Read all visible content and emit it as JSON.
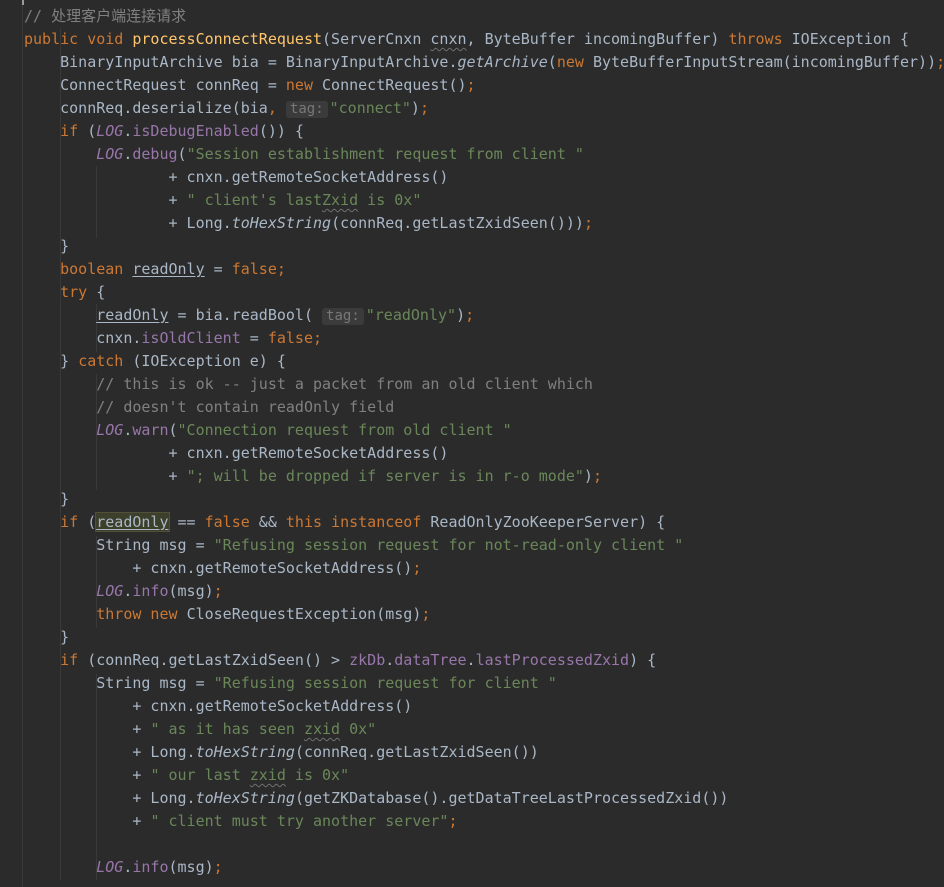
{
  "code_lines": [
    [
      {
        "c": "cmt",
        "t": "// 处理客户端连接请求"
      }
    ],
    [
      {
        "c": "kw",
        "t": "public void "
      },
      {
        "c": "fn",
        "t": "processConnectRequest"
      },
      {
        "c": "plain",
        "t": "(ServerCnxn "
      },
      {
        "c": "plain sq",
        "t": "cnxn"
      },
      {
        "c": "plain",
        "t": ", ByteBuffer incomingBuffer) "
      },
      {
        "c": "kw",
        "t": "throws "
      },
      {
        "c": "plain",
        "t": "IOException {"
      }
    ],
    [
      {
        "c": "plain",
        "t": "    BinaryInputArchive bia = BinaryInputArchive."
      },
      {
        "c": "plain smeth",
        "t": "getArchive"
      },
      {
        "c": "plain",
        "t": "("
      },
      {
        "c": "kw",
        "t": "new "
      },
      {
        "c": "plain",
        "t": "ByteBufferInputStream(incomingBuffer))"
      },
      {
        "c": "kw",
        "t": ";"
      }
    ],
    [
      {
        "c": "plain",
        "t": "    ConnectRequest connReq = "
      },
      {
        "c": "kw",
        "t": "new "
      },
      {
        "c": "plain",
        "t": "ConnectRequest()"
      },
      {
        "c": "kw",
        "t": ";"
      }
    ],
    [
      {
        "c": "plain",
        "t": "    connReq.deserialize(bia"
      },
      {
        "c": "kw",
        "t": ", "
      },
      {
        "c": "hint",
        "t": "tag:"
      },
      {
        "c": "str",
        "t": "\"connect\""
      },
      {
        "c": "plain",
        "t": ")"
      },
      {
        "c": "kw",
        "t": ";"
      }
    ],
    [
      {
        "c": "kw",
        "t": "    if "
      },
      {
        "c": "plain",
        "t": "("
      },
      {
        "c": "sfld",
        "t": "LOG"
      },
      {
        "c": "plain",
        "t": "."
      },
      {
        "c": "fld",
        "t": "isDebugEnabled"
      },
      {
        "c": "plain",
        "t": "()) {"
      }
    ],
    [
      {
        "c": "sfld",
        "t": "        LOG"
      },
      {
        "c": "plain",
        "t": "."
      },
      {
        "c": "fld",
        "t": "debug"
      },
      {
        "c": "plain",
        "t": "("
      },
      {
        "c": "str",
        "t": "\"Session establishment request from client \""
      }
    ],
    [
      {
        "c": "plain",
        "t": "                + cnxn.getRemoteSocketAddress()"
      }
    ],
    [
      {
        "c": "plain",
        "t": "                + "
      },
      {
        "c": "str",
        "t": "\" client's last"
      },
      {
        "c": "str sq",
        "t": "Zxid"
      },
      {
        "c": "str",
        "t": " is 0x\""
      }
    ],
    [
      {
        "c": "plain",
        "t": "                + Long."
      },
      {
        "c": "plain smeth",
        "t": "toHexString"
      },
      {
        "c": "plain",
        "t": "(connReq.getLastZxidSeen()))"
      },
      {
        "c": "kw",
        "t": ";"
      }
    ],
    [
      {
        "c": "plain",
        "t": "    }"
      }
    ],
    [
      {
        "c": "kw",
        "t": "    boolean "
      },
      {
        "c": "plain u",
        "t": "readOnly"
      },
      {
        "c": "plain",
        "t": " = "
      },
      {
        "c": "kw",
        "t": "false;"
      }
    ],
    [
      {
        "c": "kw",
        "t": "    try "
      },
      {
        "c": "plain",
        "t": "{"
      }
    ],
    [
      {
        "c": "plain",
        "t": "        "
      },
      {
        "c": "plain u",
        "t": "readOnly"
      },
      {
        "c": "plain",
        "t": " = bia.readBool( "
      },
      {
        "c": "hint",
        "t": "tag:"
      },
      {
        "c": "str",
        "t": "\"readOnly\""
      },
      {
        "c": "plain",
        "t": ")"
      },
      {
        "c": "kw",
        "t": ";"
      }
    ],
    [
      {
        "c": "plain",
        "t": "        cnxn."
      },
      {
        "c": "fld",
        "t": "isOldClient"
      },
      {
        "c": "plain",
        "t": " = "
      },
      {
        "c": "kw",
        "t": "false;"
      }
    ],
    [
      {
        "c": "plain",
        "t": "    } "
      },
      {
        "c": "kw",
        "t": "catch "
      },
      {
        "c": "plain",
        "t": "(IOException e) {"
      }
    ],
    [
      {
        "c": "cmt",
        "t": "        // this is ok -- just a packet from an old client which"
      }
    ],
    [
      {
        "c": "cmt",
        "t": "        // doesn't contain readOnly field"
      }
    ],
    [
      {
        "c": "sfld",
        "t": "        LOG"
      },
      {
        "c": "plain",
        "t": "."
      },
      {
        "c": "fld",
        "t": "warn"
      },
      {
        "c": "plain",
        "t": "("
      },
      {
        "c": "str",
        "t": "\"Connection request from old client \""
      }
    ],
    [
      {
        "c": "plain",
        "t": "                + cnxn.getRemoteSocketAddress()"
      }
    ],
    [
      {
        "c": "plain",
        "t": "                + "
      },
      {
        "c": "str",
        "t": "\"; will be dropped if server is in r-o mode\""
      },
      {
        "c": "plain",
        "t": ")"
      },
      {
        "c": "kw",
        "t": ";"
      }
    ],
    [
      {
        "c": "plain",
        "t": "    }"
      }
    ],
    [
      {
        "c": "kw",
        "t": "    if "
      },
      {
        "c": "plain",
        "t": "("
      },
      {
        "c": "plain u hl-box",
        "t": "readOnly"
      },
      {
        "c": "plain",
        "t": " == "
      },
      {
        "c": "kw",
        "t": "false"
      },
      {
        "c": "plain",
        "t": " && "
      },
      {
        "c": "kw",
        "t": "this instanceof "
      },
      {
        "c": "plain",
        "t": "ReadOnlyZooKeeperServer) {"
      }
    ],
    [
      {
        "c": "plain",
        "t": "        String msg = "
      },
      {
        "c": "str",
        "t": "\"Refusing session request for not-read-only client \""
      }
    ],
    [
      {
        "c": "plain",
        "t": "            + cnxn.getRemoteSocketAddress()"
      },
      {
        "c": "kw",
        "t": ";"
      }
    ],
    [
      {
        "c": "sfld",
        "t": "        LOG"
      },
      {
        "c": "plain",
        "t": "."
      },
      {
        "c": "fld",
        "t": "info"
      },
      {
        "c": "plain",
        "t": "(msg)"
      },
      {
        "c": "kw",
        "t": ";"
      }
    ],
    [
      {
        "c": "kw",
        "t": "        throw new "
      },
      {
        "c": "plain",
        "t": "CloseRequestException(msg)"
      },
      {
        "c": "kw",
        "t": ";"
      }
    ],
    [
      {
        "c": "plain",
        "t": "    }"
      }
    ],
    [
      {
        "c": "kw",
        "t": "    if "
      },
      {
        "c": "plain",
        "t": "(connReq.getLastZxidSeen() > "
      },
      {
        "c": "fld",
        "t": "zkDb"
      },
      {
        "c": "plain",
        "t": "."
      },
      {
        "c": "fld",
        "t": "dataTree"
      },
      {
        "c": "plain",
        "t": "."
      },
      {
        "c": "fld",
        "t": "lastProcessedZxid"
      },
      {
        "c": "plain",
        "t": ") {"
      }
    ],
    [
      {
        "c": "plain",
        "t": "        String msg = "
      },
      {
        "c": "str",
        "t": "\"Refusing session request for client \""
      }
    ],
    [
      {
        "c": "plain",
        "t": "            + cnxn.getRemoteSocketAddress()"
      }
    ],
    [
      {
        "c": "plain",
        "t": "            + "
      },
      {
        "c": "str",
        "t": "\" as it has seen "
      },
      {
        "c": "str sq",
        "t": "zxid"
      },
      {
        "c": "str",
        "t": " 0x\""
      }
    ],
    [
      {
        "c": "plain",
        "t": "            + Long."
      },
      {
        "c": "plain smeth",
        "t": "toHexString"
      },
      {
        "c": "plain",
        "t": "(connReq.getLastZxidSeen())"
      }
    ],
    [
      {
        "c": "plain",
        "t": "            + "
      },
      {
        "c": "str",
        "t": "\" our last "
      },
      {
        "c": "str sq",
        "t": "zxid"
      },
      {
        "c": "str",
        "t": " is 0x\""
      }
    ],
    [
      {
        "c": "plain",
        "t": "            + Long."
      },
      {
        "c": "plain smeth",
        "t": "toHexString"
      },
      {
        "c": "plain",
        "t": "(getZKDatabase().getDataTreeLastProcessedZxid())"
      }
    ],
    [
      {
        "c": "plain",
        "t": "            + "
      },
      {
        "c": "str",
        "t": "\" client must try another server\""
      },
      {
        "c": "kw",
        "t": ";"
      }
    ],
    [],
    [
      {
        "c": "sfld",
        "t": "        LOG"
      },
      {
        "c": "plain",
        "t": "."
      },
      {
        "c": "fld",
        "t": "info"
      },
      {
        "c": "plain",
        "t": "(msg)"
      },
      {
        "c": "kw",
        "t": ";"
      }
    ]
  ]
}
